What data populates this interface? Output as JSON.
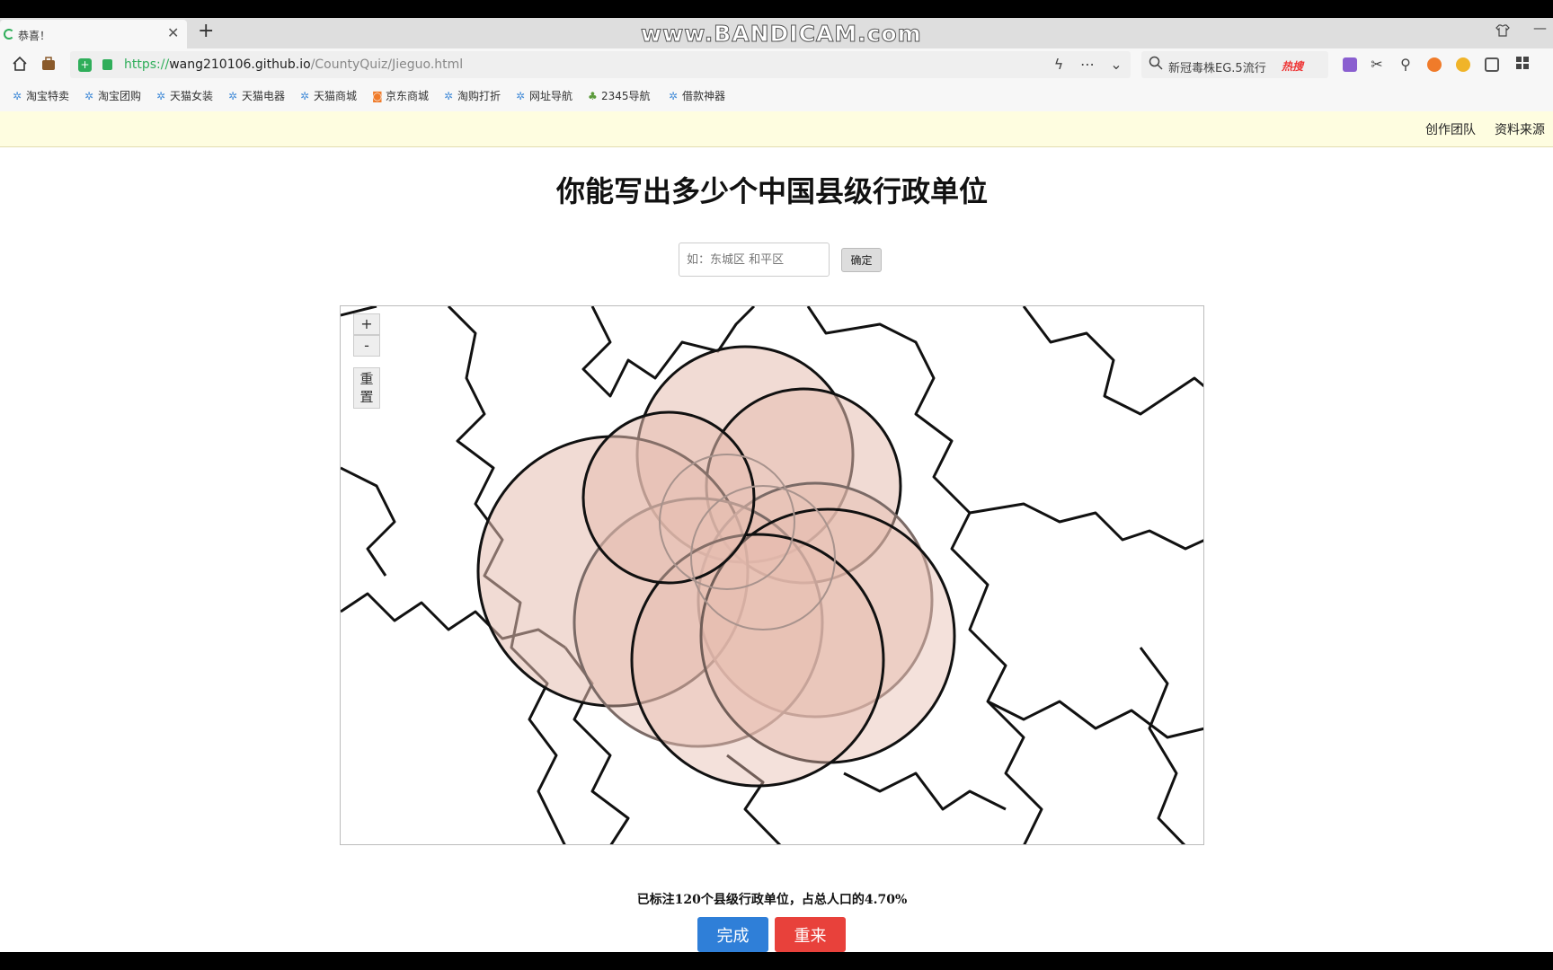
{
  "watermark": "www.BANDICAM.com",
  "browser": {
    "tab_title": "恭喜！",
    "new_tab_label": "+",
    "close_label": "✕",
    "url_scheme": "https://",
    "url_host": "wang210106.github.io",
    "url_path": "/CountyQuiz/Jieguo.html",
    "search_text": "新冠毒株EG.5流行",
    "search_hot_label": "热搜",
    "bookmarks": [
      "淘宝特卖",
      "淘宝团购",
      "天猫女装",
      "天猫电器",
      "天猫商城",
      "京东商城",
      "淘购打折",
      "网址导航",
      "2345导航",
      "借款神器"
    ]
  },
  "page": {
    "top_links": [
      "创作团队",
      "资料来源"
    ],
    "title": "你能写出多少个中国县级行政单位",
    "input_placeholder": "如：东城区 和平区",
    "confirm_label": "确定",
    "map_controls": {
      "zoom_in": "+",
      "zoom_out": "-",
      "reset": "重置"
    },
    "result_text": "已标注120个县级行政单位，占总人口的4.70%",
    "done_label": "完成",
    "retry_label": "重来"
  },
  "colors": {
    "accent_green": "#2fae5a",
    "done_blue": "#2f7fd8",
    "retry_red": "#e8413b",
    "circle_fill": "#e6bdb0"
  }
}
